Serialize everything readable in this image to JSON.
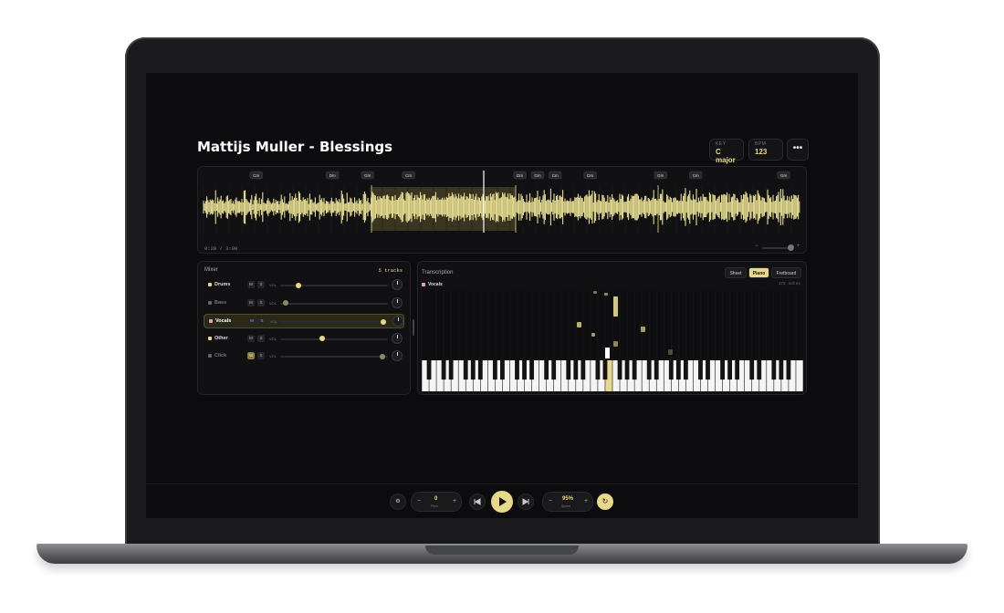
{
  "song_title": "Mattijs Muller - Blessings",
  "stats": {
    "key_label": "KEY",
    "key_value": "C major",
    "bpm_label": "BPM",
    "bpm_value": "123"
  },
  "more_label": "•••",
  "waveform": {
    "time": "0:28 / 3:00",
    "chords": [
      {
        "label": "Cm",
        "at": 0.09
      },
      {
        "label": "Dm",
        "at": 0.22
      },
      {
        "label": "Gm",
        "at": 0.28
      },
      {
        "label": "Cm",
        "at": 0.35
      },
      {
        "label": "Dm",
        "at": 0.54
      },
      {
        "label": "Gm",
        "at": 0.57
      },
      {
        "label": "Cm",
        "at": 0.6
      },
      {
        "label": "Dm",
        "at": 0.66
      },
      {
        "label": "Gm",
        "at": 0.78
      },
      {
        "label": "Cm",
        "at": 0.84
      },
      {
        "label": "Gm",
        "at": 0.99
      }
    ],
    "zoom_minus": "−",
    "zoom_plus": "+"
  },
  "mixer": {
    "title": "Mixer",
    "count": "5 tracks",
    "tracks": [
      {
        "name": "Drums",
        "color": "#e8d98a",
        "muted_label": "M",
        "solo_label": "S",
        "vol_label": "VOL",
        "volume": 0.15,
        "active": false,
        "dim": false
      },
      {
        "name": "Bass",
        "color": "#666666",
        "muted_label": "M",
        "solo_label": "S",
        "vol_label": "VOL",
        "volume": 0.03,
        "active": false,
        "dim": true
      },
      {
        "name": "Vocals",
        "color": "#e8a0c0",
        "muted_label": "M",
        "solo_label": "S",
        "vol_label": "VOL",
        "volume": 0.97,
        "active": true,
        "dim": false
      },
      {
        "name": "Other",
        "color": "#e8d98a",
        "muted_label": "M",
        "solo_label": "S",
        "vol_label": "VOL",
        "volume": 0.38,
        "active": false,
        "dim": false
      },
      {
        "name": "Click",
        "color": "#666666",
        "muted_label": "M",
        "solo_label": "S",
        "vol_label": "VOL",
        "volume": 0.97,
        "active": false,
        "dim": true
      }
    ]
  },
  "transcription": {
    "title": "Transcription",
    "modes": [
      "Sheet",
      "Piano",
      "Fretboard"
    ],
    "selected_mode": "Piano",
    "instrument": "Vocals",
    "notes_count": "172 notes"
  },
  "transport": {
    "settings_icon": "⚙",
    "pitch_value": "0",
    "pitch_label": "Pitch",
    "speed_value": "95%",
    "speed_label": "Speed",
    "minus": "−",
    "plus": "+",
    "loop_icon": "↻"
  }
}
